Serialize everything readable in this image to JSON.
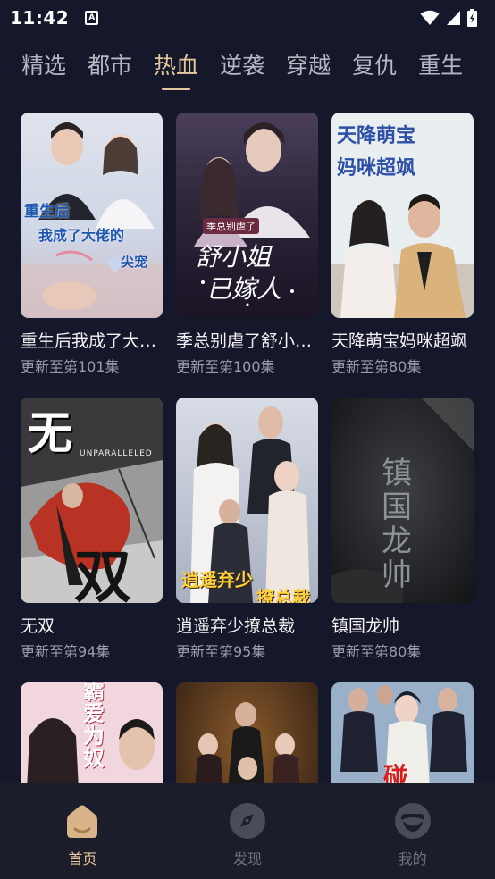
{
  "status": {
    "time": "11:42",
    "notif": "A"
  },
  "tabs": [
    {
      "label": "精选",
      "active": false
    },
    {
      "label": "都市",
      "active": false
    },
    {
      "label": "热血",
      "active": true
    },
    {
      "label": "逆袭",
      "active": false
    },
    {
      "label": "穿越",
      "active": false
    },
    {
      "label": "复仇",
      "active": false
    },
    {
      "label": "重生",
      "active": false
    }
  ],
  "cards": [
    {
      "title": "重生后我成了大佬的尖宠",
      "subtitle": "更新至第101集",
      "cover_text": [
        "重生后",
        "我成了大佬的",
        "尖宠"
      ]
    },
    {
      "title": "季总别虐了舒小姐已嫁人",
      "subtitle": "更新至第100集",
      "cover_text": [
        "季总别虐了",
        "舒小姐",
        "已嫁人"
      ]
    },
    {
      "title": "天降萌宝妈咪超飒",
      "subtitle": "更新至第80集",
      "cover_text": [
        "天降萌宝",
        "妈咪超飒"
      ]
    },
    {
      "title": "无双",
      "subtitle": "更新至第94集",
      "cover_text": [
        "无",
        "UNPARALLELED",
        "双"
      ]
    },
    {
      "title": "逍遥弃少撩总裁",
      "subtitle": "更新至第95集",
      "cover_text": [
        "逍遥弃少",
        "撩总裁"
      ]
    },
    {
      "title": "镇国龙帅",
      "subtitle": "更新至第80集",
      "cover_text": [
        "镇国龙帅"
      ]
    },
    {
      "title": "",
      "subtitle": "",
      "cover_text": [
        "霸",
        "爱",
        "为",
        "奴"
      ]
    },
    {
      "title": "",
      "subtitle": "",
      "cover_text": []
    },
    {
      "title": "",
      "subtitle": "",
      "cover_text": [
        "碰"
      ]
    }
  ],
  "nav": [
    {
      "label": "首页",
      "active": true,
      "icon": "home-icon"
    },
    {
      "label": "发现",
      "active": false,
      "icon": "compass-icon"
    },
    {
      "label": "我的",
      "active": false,
      "icon": "profile-icon"
    }
  ],
  "colors": {
    "accent": "#e7c79c",
    "background": "#15182a",
    "nav_bg": "#1b1d2a"
  }
}
